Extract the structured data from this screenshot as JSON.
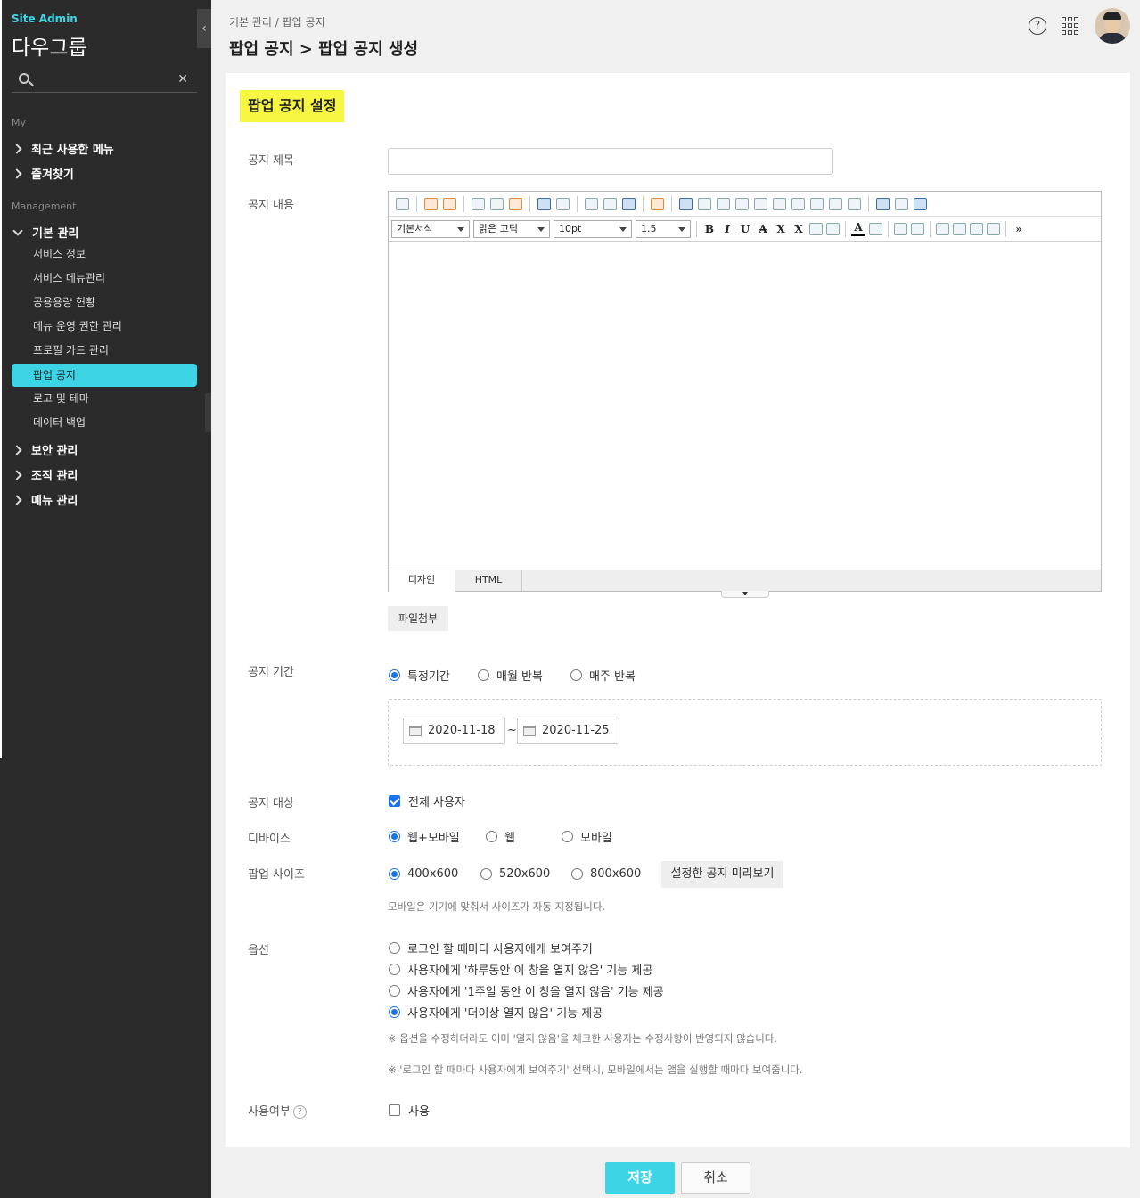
{
  "sidebar": {
    "site_admin": "Site Admin",
    "brand": "다우그룹",
    "search_placeholder": "",
    "section_my": "My",
    "my_groups": [
      "최근 사용한 메뉴",
      "즐겨찾기"
    ],
    "section_management": "Management",
    "basic_group": "기본 관리",
    "basic_items": [
      "서비스 정보",
      "서비스 메뉴관리",
      "공용용량 현황",
      "메뉴 운영 권한 관리",
      "프로필 카드 관리",
      "팝업 공지",
      "로고 및 테마",
      "데이터 백업"
    ],
    "other_groups": [
      "보안 관리",
      "조직 관리",
      "메뉴 관리"
    ]
  },
  "header": {
    "breadcrumb": "기본 관리 / 팝업 공지",
    "title": "팝업 공지 > 팝업 공지 생성",
    "help_glyph": "?"
  },
  "form": {
    "section_title": "팝업 공지 설정",
    "labels": {
      "title": "공지 제목",
      "content": "공지 내용",
      "period": "공지 기간",
      "target": "공지 대상",
      "device": "디바이스",
      "size": "팝업 사이즈",
      "options": "옵션",
      "usage": "사용여부"
    },
    "title_value": "",
    "editor": {
      "font_format": "기본서식",
      "font_family": "맑은 고딕",
      "font_size": "10pt",
      "line_height": "1.5",
      "tab_design": "디자인",
      "tab_html": "HTML"
    },
    "attach_button": "파일첨부",
    "period_options": [
      "특정기간",
      "매월 반복",
      "매주 반복"
    ],
    "date_start": "2020-11-18",
    "date_end": "2020-11-25",
    "date_separator": "~",
    "target_all": "전체 사용자",
    "device_options": [
      "웹+모바일",
      "웹",
      "모바일"
    ],
    "size_options": [
      "400x600",
      "520x600",
      "800x600"
    ],
    "preview_button": "설정한 공지 미리보기",
    "size_note": "모바일은 기기에 맞춰서 사이즈가 자동 지정됩니다.",
    "option_items": [
      "로그인 할 때마다 사용자에게 보여주기",
      "사용자에게 '하루동안 이 창을 열지 않음' 기능 제공",
      "사용자에게 '1주일 동안 이 창을 열지 않음' 기능 제공",
      "사용자에게 '더이상 열지 않음' 기능 제공"
    ],
    "option_note_1": "※ 옵션을 수정하더라도 이미 '열지 않음'을 체크한 사용자는 수정사항이 반영되지 않습니다.",
    "option_note_2": "※ '로그인 할 때마다 사용자에게 보여주기' 선택시, 모바일에서는 앱을 실행할 때마다 보여줍니다.",
    "usage_check": "사용",
    "usage_help_glyph": "?"
  },
  "footer": {
    "save": "저장",
    "cancel": "취소"
  },
  "colors": {
    "accent": "#3dd5e6",
    "highlight": "#f5f542",
    "sidebar_bg": "#2b2b2b"
  }
}
